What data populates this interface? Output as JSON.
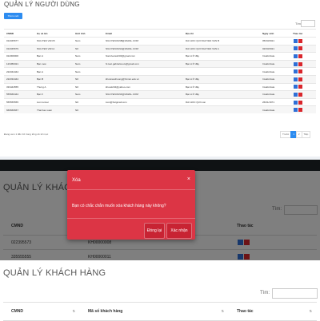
{
  "users_panel": {
    "title": "QUẢN LÝ NGƯỜI DÙNG",
    "add_button": "Thêm mới",
    "search_label": "Tìm:",
    "columns": [
      "CMND",
      "Họ và tên",
      "Giới tính",
      "Email",
      "Địa chỉ",
      "Ngày sinh",
      "Thao tác"
    ],
    "rows": [
      [
        "012345677",
        "NGUYEN VAN B",
        "Nam",
        "NGUYENVANB@GMAIL.COM",
        "DAI HOC QUI NGUYEN VAN B",
        "05/03/2021"
      ],
      [
        "012345679",
        "NGUYEN VAN A",
        "Nữ",
        "NGUYENVANA@GMAIL.COM",
        "DAI HOC QUI NGUYEN VAN A",
        "02/03/2021"
      ],
      [
        "012300000",
        "Bạn A",
        "Nam",
        "hiacvivara1234@gmail.com",
        "Bạn A Ở đây",
        "Invalid date"
      ],
      [
        "123456321",
        "Bạn new",
        "Nam",
        "hi.test.gabrielcou.k@gmail.com",
        "Bạn A Ở đây",
        "Invalid date"
      ],
      [
        "222344444",
        "Bạn A",
        "Nam",
        "",
        "",
        "Invalid date"
      ],
      [
        "222334444",
        "Bạn B",
        "Nữ",
        "khoisnewhuong@hcmut.edu.vn",
        "Bạn A Ở đây",
        "Invalid date"
      ],
      [
        "333444555",
        "Thưng A",
        "Nữ",
        "khoa1234@yahoo.com",
        "Bạn A Ở đây",
        "Invalid date"
      ],
      [
        "555666444",
        "Bạn F",
        "Nam",
        "NGUYENVANF@GMAIL.COM",
        "Bạn A Ở đây",
        "Invalid date"
      ],
      [
        "555555555",
        "Lion tunner",
        "Nữ",
        "Lion@hotgmail.com",
        "DAI HOC QUI Lion",
        "26/01/1971"
      ],
      [
        "666666667",
        "Thai bao xuan",
        "Nữ",
        "",
        "",
        "Invalid date"
      ]
    ],
    "info": "Đang xem 1 đến 10 trong tổng số 12 mục",
    "pager": [
      "Trước",
      "1",
      "2",
      "Tiếp"
    ]
  },
  "customers_panel": {
    "title": "QUẢN LÝ KHÁCH HÀNG",
    "search_label": "Tìm:",
    "columns": [
      "CMND",
      "Mã số khách hàng",
      "Thao tác"
    ],
    "rows": [
      [
        "022395573",
        "KH00000008"
      ],
      [
        "335555555",
        "KH00000011"
      ]
    ],
    "modal": {
      "title": "Xóa",
      "close_symbol": "×",
      "message": "Bạn có chắc chắn muốn xóa khách hàng này không?",
      "close_button": "Đóng lại",
      "confirm_button": "Xác nhận"
    }
  },
  "customers_panel_2": {
    "title": "QUẢN LÝ KHÁCH HÀNG",
    "search_label": "Tìm:",
    "columns": [
      "CMND",
      "Mã số khách hàng",
      "Thao tác"
    ]
  },
  "colors": {
    "primary": "#2d8cf0",
    "danger": "#dc3545",
    "edit_icon": "#2f6fd6",
    "delete_icon": "#d9262c"
  }
}
